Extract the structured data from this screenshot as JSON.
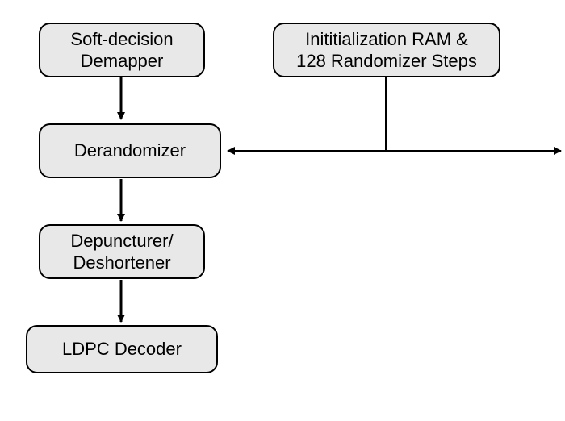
{
  "blocks": {
    "demapper": {
      "line1": "Soft-decision",
      "line2": "Demapper"
    },
    "derandomizer": "Derandomizer",
    "depuncturer": {
      "line1": "Depuncturer/",
      "line2": "Deshortener"
    },
    "ldpc": "LDPC Decoder",
    "init": {
      "line1": "Inititialization RAM &",
      "line2": "128 Randomizer Steps"
    }
  }
}
